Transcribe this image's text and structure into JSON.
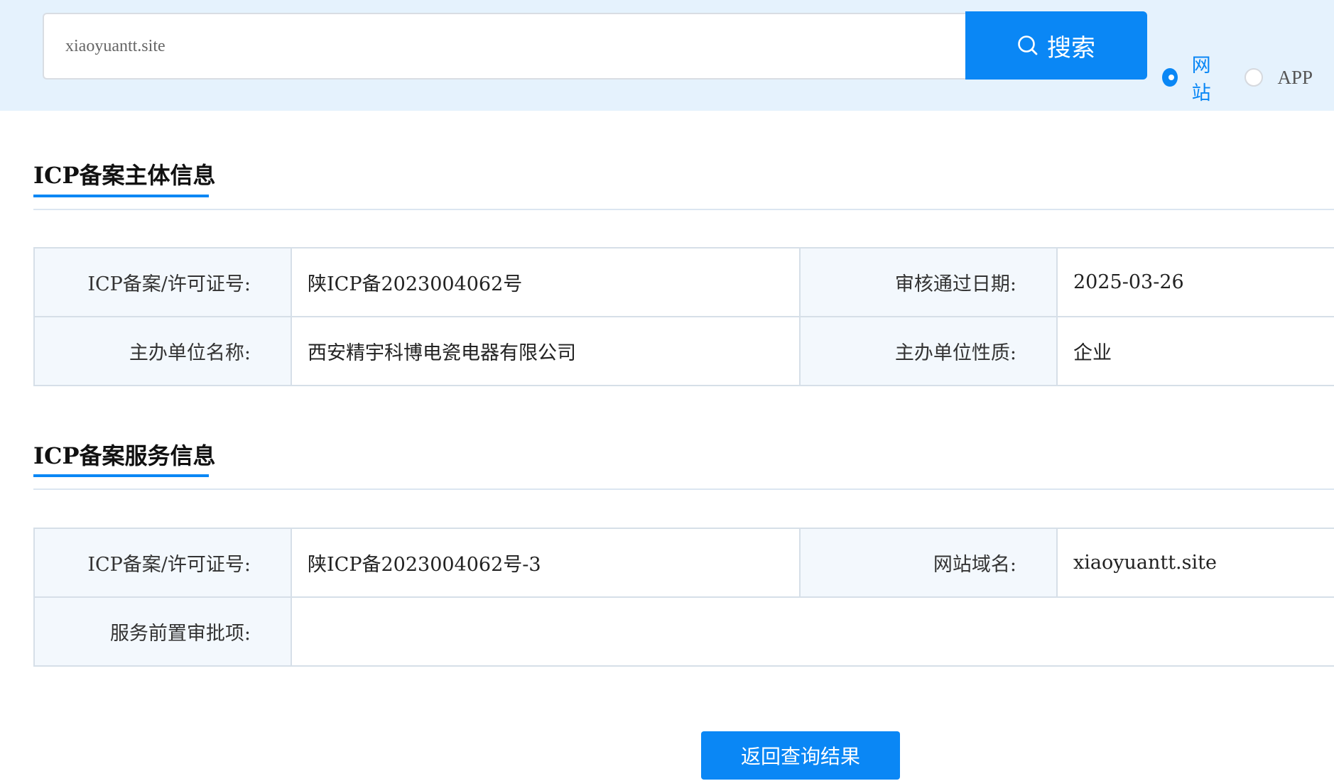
{
  "search": {
    "value": "xiaoyuantt.site",
    "button_label": "搜索",
    "search_icon": "search-icon"
  },
  "type_filter": {
    "options": [
      {
        "label": "网站",
        "checked": true
      },
      {
        "label": "APP",
        "checked": false
      }
    ]
  },
  "sections": [
    {
      "title": "ICP备案主体信息",
      "rows": [
        [
          {
            "label": "ICP备案/许可证号:",
            "value": "陕ICP备2023004062号"
          },
          {
            "label": "审核通过日期:",
            "value": "2025-03-26"
          }
        ],
        [
          {
            "label": "主办单位名称:",
            "value": "西安精宇科博电瓷电器有限公司"
          },
          {
            "label": "主办单位性质:",
            "value": "企业"
          }
        ]
      ]
    },
    {
      "title": "ICP备案服务信息",
      "rows": [
        [
          {
            "label": "ICP备案/许可证号:",
            "value": "陕ICP备2023004062号-3"
          },
          {
            "label": "网站域名:",
            "value": "xiaoyuantt.site"
          }
        ],
        [
          {
            "label": "服务前置审批项:",
            "value": ""
          }
        ]
      ]
    }
  ],
  "back_button_label": "返回查询结果",
  "colors": {
    "accent": "#0a87f5",
    "band": "#e5f2fd",
    "label_bg": "#f3f8fd",
    "border": "#d6dfe8"
  }
}
